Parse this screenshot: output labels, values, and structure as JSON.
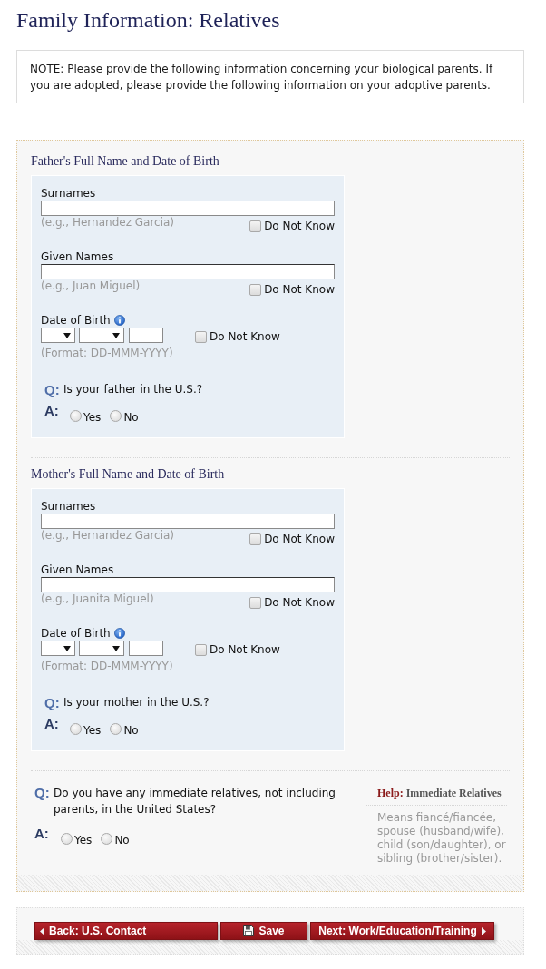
{
  "page_title": "Family Information: Relatives",
  "note": "NOTE: Please provide the following information concerning your biological parents. If you are adopted, please provide the following information on your adoptive parents.",
  "parents": [
    {
      "heading": "Father's Full Name and Date of Birth",
      "fields": [
        {
          "kind": "text",
          "label": "Surnames",
          "hint": "(e.g., Hernandez Garcia)",
          "do_not_know": {
            "label": "Do Not Know",
            "checked": false
          }
        },
        {
          "kind": "text",
          "label": "Given Names",
          "hint": "(e.g., Juan Miguel)",
          "do_not_know": {
            "label": "Do Not Know",
            "checked": false
          }
        },
        {
          "kind": "date",
          "label": "Date of Birth",
          "hint": "(Format: DD-MMM-YYYY)",
          "do_not_know": {
            "label": "Do Not Know",
            "checked": false
          }
        }
      ],
      "question": {
        "q_marker": "Q:",
        "text": "Is your father in the U.S.?",
        "a_marker": "A:",
        "options": [
          {
            "label": "Yes",
            "selected": false
          },
          {
            "label": "No",
            "selected": false
          }
        ]
      }
    },
    {
      "heading": "Mother's Full Name and Date of Birth",
      "fields": [
        {
          "kind": "text",
          "label": "Surnames",
          "hint": "(e.g., Hernandez Garcia)",
          "do_not_know": {
            "label": "Do Not Know",
            "checked": false
          }
        },
        {
          "kind": "text",
          "label": "Given Names",
          "hint": "(e.g., Juanita Miguel)",
          "do_not_know": {
            "label": "Do Not Know",
            "checked": false
          }
        },
        {
          "kind": "date",
          "label": "Date of Birth",
          "hint": "(Format: DD-MMM-YYYY)",
          "do_not_know": {
            "label": "Do Not Know",
            "checked": false
          }
        }
      ],
      "question": {
        "q_marker": "Q:",
        "text": "Is your mother in the U.S.?",
        "a_marker": "A:",
        "options": [
          {
            "label": "Yes",
            "selected": false
          },
          {
            "label": "No",
            "selected": false
          }
        ]
      }
    }
  ],
  "relatives_question": {
    "q_marker": "Q:",
    "text": "Do you have any immediate relatives, not including parents, in the United States?",
    "a_marker": "A:",
    "options": [
      {
        "label": "Yes",
        "selected": false
      },
      {
        "label": "No",
        "selected": false
      }
    ]
  },
  "help": {
    "prefix": "Help:",
    "title": "Immediate Relatives",
    "text": "Means fiancé/fiancée, spouse (husband/wife), child (son/daughter), or sibling (brother/sister)."
  },
  "buttons": [
    {
      "kind": "back",
      "label": "Back: U.S. Contact"
    },
    {
      "kind": "save",
      "label": "Save"
    },
    {
      "kind": "next",
      "label": "Next: Work/Education/Training"
    }
  ]
}
